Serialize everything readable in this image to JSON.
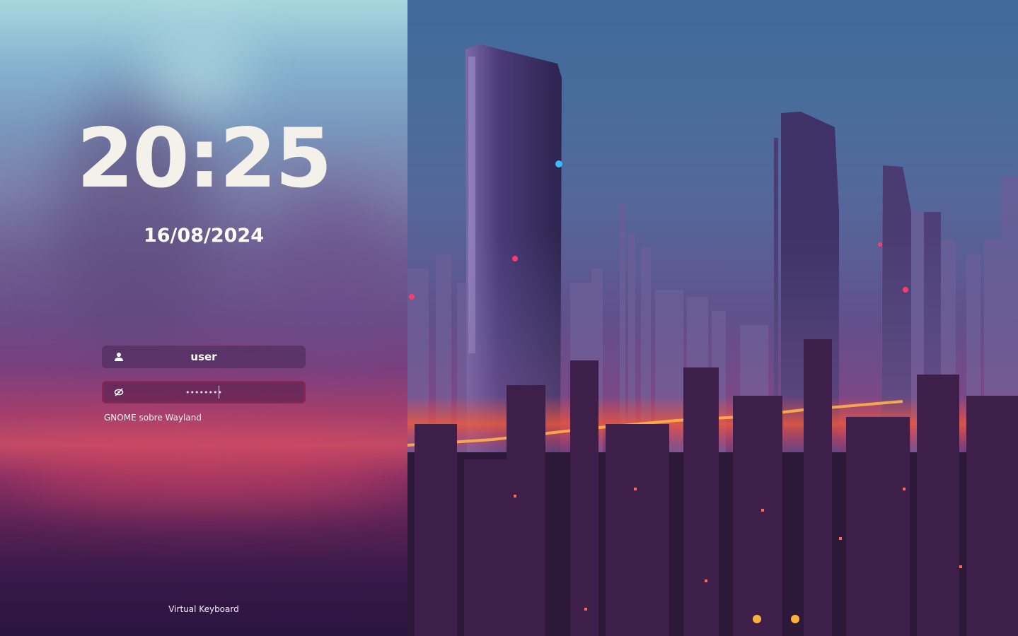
{
  "clock": {
    "time": "20:25",
    "date": "16/08/2024"
  },
  "login": {
    "username": "user",
    "password_value": "••••••••",
    "user_icon": "user-icon",
    "password_icon": "eye-slash-icon"
  },
  "session": {
    "label": "GNOME sobre Wayland"
  },
  "footer": {
    "virtual_keyboard_label": "Virtual Keyboard"
  },
  "colors": {
    "accent_border": "#962350",
    "text": "#ffffff"
  },
  "wallpaper": {
    "subject": "cyberpunk-city-icon"
  }
}
